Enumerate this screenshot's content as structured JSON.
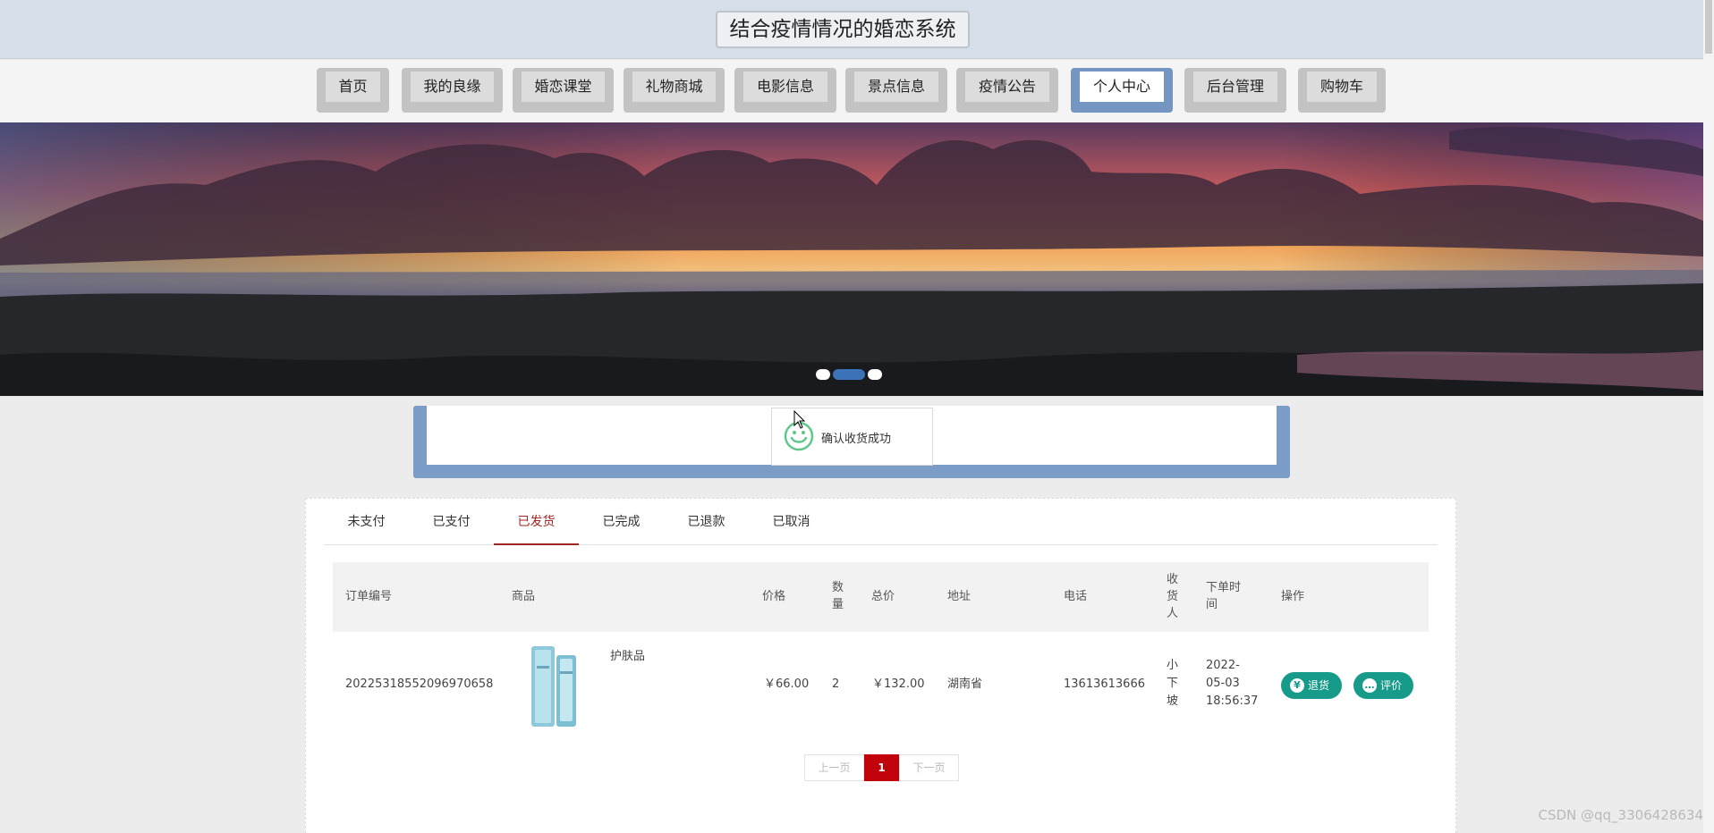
{
  "header": {
    "title": "结合疫情情况的婚恋系统"
  },
  "nav": {
    "items": [
      {
        "label": "首页",
        "active": false
      },
      {
        "label": "我的良缘",
        "active": false
      },
      {
        "label": "婚恋课堂",
        "active": false
      },
      {
        "label": "礼物商城",
        "active": false
      },
      {
        "label": "电影信息",
        "active": false
      },
      {
        "label": "景点信息",
        "active": false
      },
      {
        "label": "疫情公告",
        "active": false
      },
      {
        "label": "个人中心",
        "active": true
      },
      {
        "label": "后台管理",
        "active": false
      },
      {
        "label": "购物车",
        "active": false
      }
    ]
  },
  "banner": {
    "active_slide": 2,
    "slide_count": 3
  },
  "toast": {
    "message": "确认收货成功",
    "icon": "smiley-icon"
  },
  "order_tabs": {
    "items": [
      "未支付",
      "已支付",
      "已发货",
      "已完成",
      "已退款",
      "已取消"
    ],
    "active": "已发货"
  },
  "orders": {
    "columns": [
      "订单编号",
      "商品",
      "价格",
      "数\n量",
      "总价",
      "地址",
      "电话",
      "收\n货\n人",
      "下单时\n间",
      "操作"
    ],
    "rows": [
      {
        "order_no": "20225318552096970658",
        "product_name": "护肤品",
        "product_image": "skincare-bottle",
        "price": "￥66.00",
        "quantity": "2",
        "total": "￥132.00",
        "address": "湖南省",
        "phone": "13613613666",
        "receiver": "小\n下\n坡",
        "order_time": "2022-\n05-03\n18:56:37",
        "refund_label": "退货",
        "review_label": "评价"
      }
    ]
  },
  "pagination": {
    "prev": "上一页",
    "current": "1",
    "next": "下一页"
  },
  "watermark": "CSDN @qq_3306428634",
  "colors": {
    "accent": "#169a8a",
    "active_tab": "#a12522",
    "page_current": "#c2020a",
    "nav_active": "#7596c2"
  }
}
